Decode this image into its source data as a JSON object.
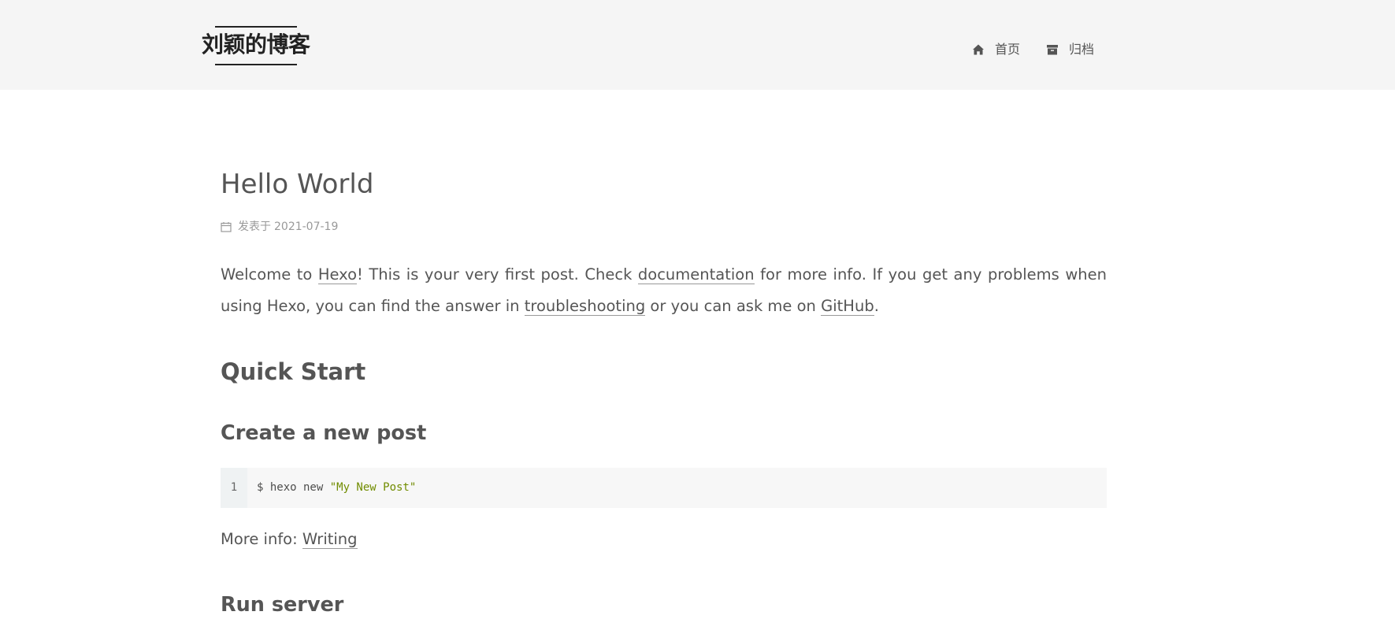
{
  "header": {
    "brand": "刘颖的博客",
    "nav": [
      {
        "label": "首页",
        "icon": "home-icon"
      },
      {
        "label": "归档",
        "icon": "archive-icon"
      }
    ]
  },
  "post": {
    "title": "Hello World",
    "meta": {
      "icon": "calendar-icon",
      "label": "发表于",
      "date": "2021-07-19"
    },
    "intro": {
      "t1": "Welcome to ",
      "link1": "Hexo",
      "t2": "! This is your very first post. Check ",
      "link2": "documentation",
      "t3": " for more info. If you get any problems when using Hexo, you can find the answer in ",
      "link3": "troubleshooting",
      "t4": " or you can ask me on ",
      "link4": "GitHub",
      "t5": "."
    },
    "quick_start": "Quick Start",
    "create_heading": "Create a new post",
    "code": {
      "line_number": "1",
      "command": "$ hexo new ",
      "string": "\"My New Post\""
    },
    "more_info": {
      "label": "More info: ",
      "link": "Writing"
    },
    "run_heading": "Run server"
  },
  "colors": {
    "header_bg": "#f5f5f5",
    "text": "#555555",
    "meta_text": "#999999",
    "code_bg": "#f7f7f7",
    "code_gutter_bg": "#eff2f3",
    "code_string": "#718c00"
  }
}
